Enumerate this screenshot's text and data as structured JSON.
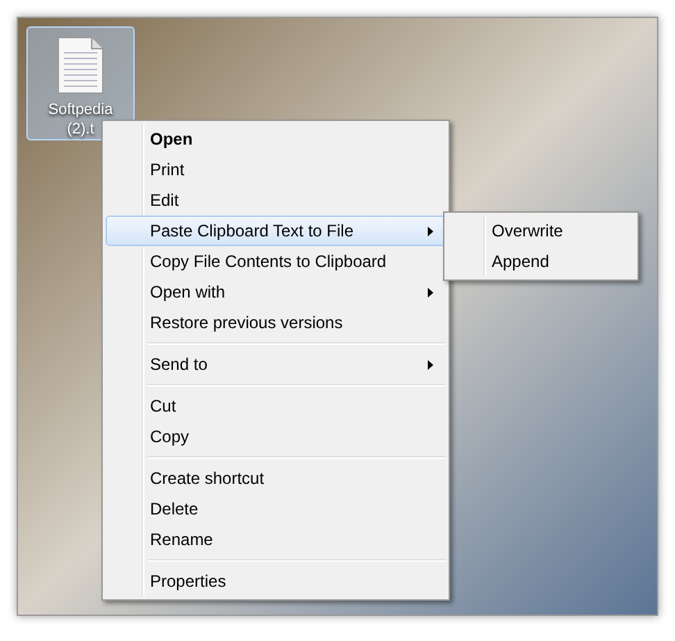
{
  "desktop_icon": {
    "label": "Softpedia (2).t",
    "selected": true
  },
  "context_menu": {
    "items": [
      {
        "kind": "item",
        "label": "Open",
        "bold": true,
        "submenu": false,
        "selected": false
      },
      {
        "kind": "item",
        "label": "Print",
        "bold": false,
        "submenu": false,
        "selected": false
      },
      {
        "kind": "item",
        "label": "Edit",
        "bold": false,
        "submenu": false,
        "selected": false
      },
      {
        "kind": "item",
        "label": "Paste Clipboard Text to File",
        "bold": false,
        "submenu": true,
        "selected": true
      },
      {
        "kind": "item",
        "label": "Copy File Contents to Clipboard",
        "bold": false,
        "submenu": false,
        "selected": false
      },
      {
        "kind": "item",
        "label": "Open with",
        "bold": false,
        "submenu": true,
        "selected": false
      },
      {
        "kind": "item",
        "label": "Restore previous versions",
        "bold": false,
        "submenu": false,
        "selected": false
      },
      {
        "kind": "separator"
      },
      {
        "kind": "item",
        "label": "Send to",
        "bold": false,
        "submenu": true,
        "selected": false
      },
      {
        "kind": "separator"
      },
      {
        "kind": "item",
        "label": "Cut",
        "bold": false,
        "submenu": false,
        "selected": false
      },
      {
        "kind": "item",
        "label": "Copy",
        "bold": false,
        "submenu": false,
        "selected": false
      },
      {
        "kind": "separator"
      },
      {
        "kind": "item",
        "label": "Create shortcut",
        "bold": false,
        "submenu": false,
        "selected": false
      },
      {
        "kind": "item",
        "label": "Delete",
        "bold": false,
        "submenu": false,
        "selected": false
      },
      {
        "kind": "item",
        "label": "Rename",
        "bold": false,
        "submenu": false,
        "selected": false
      },
      {
        "kind": "separator"
      },
      {
        "kind": "item",
        "label": "Properties",
        "bold": false,
        "submenu": false,
        "selected": false
      }
    ]
  },
  "submenu": {
    "items": [
      {
        "label": "Overwrite",
        "selected": false
      },
      {
        "label": "Append",
        "selected": false
      }
    ]
  }
}
